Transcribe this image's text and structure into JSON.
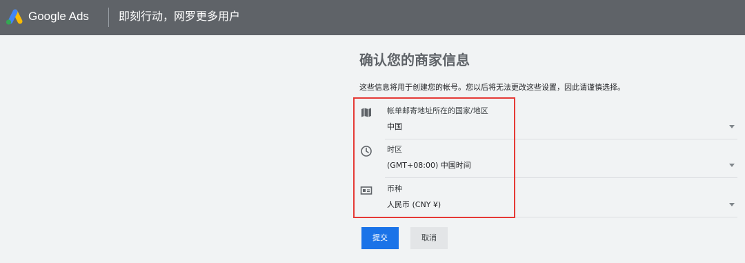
{
  "header": {
    "brand": "Google Ads",
    "tagline": "即刻行动，网罗更多用户",
    "logo_icon": "google-ads-logo",
    "colors": {
      "bar": "#5f6368",
      "logo_blue": "#4285f4",
      "logo_yellow": "#fbbc04",
      "logo_green": "#34a853"
    }
  },
  "main": {
    "title": "确认您的商家信息",
    "description": "这些信息将用于创建您的帐号。您以后将无法更改这些设置，因此请谨慎选择。",
    "fields": [
      {
        "icon": "map-icon",
        "label": "帐单邮寄地址所在的国家/地区",
        "value": "中国"
      },
      {
        "icon": "clock-icon",
        "label": "时区",
        "value": "(GMT+08:00) 中国时间"
      },
      {
        "icon": "currency-icon",
        "label": "币种",
        "value": "人民币 (CNY ¥)"
      }
    ],
    "highlight_color": "#e53935"
  },
  "actions": {
    "submit_label": "提交",
    "cancel_label": "取消",
    "submit_color": "#1a73e8"
  }
}
